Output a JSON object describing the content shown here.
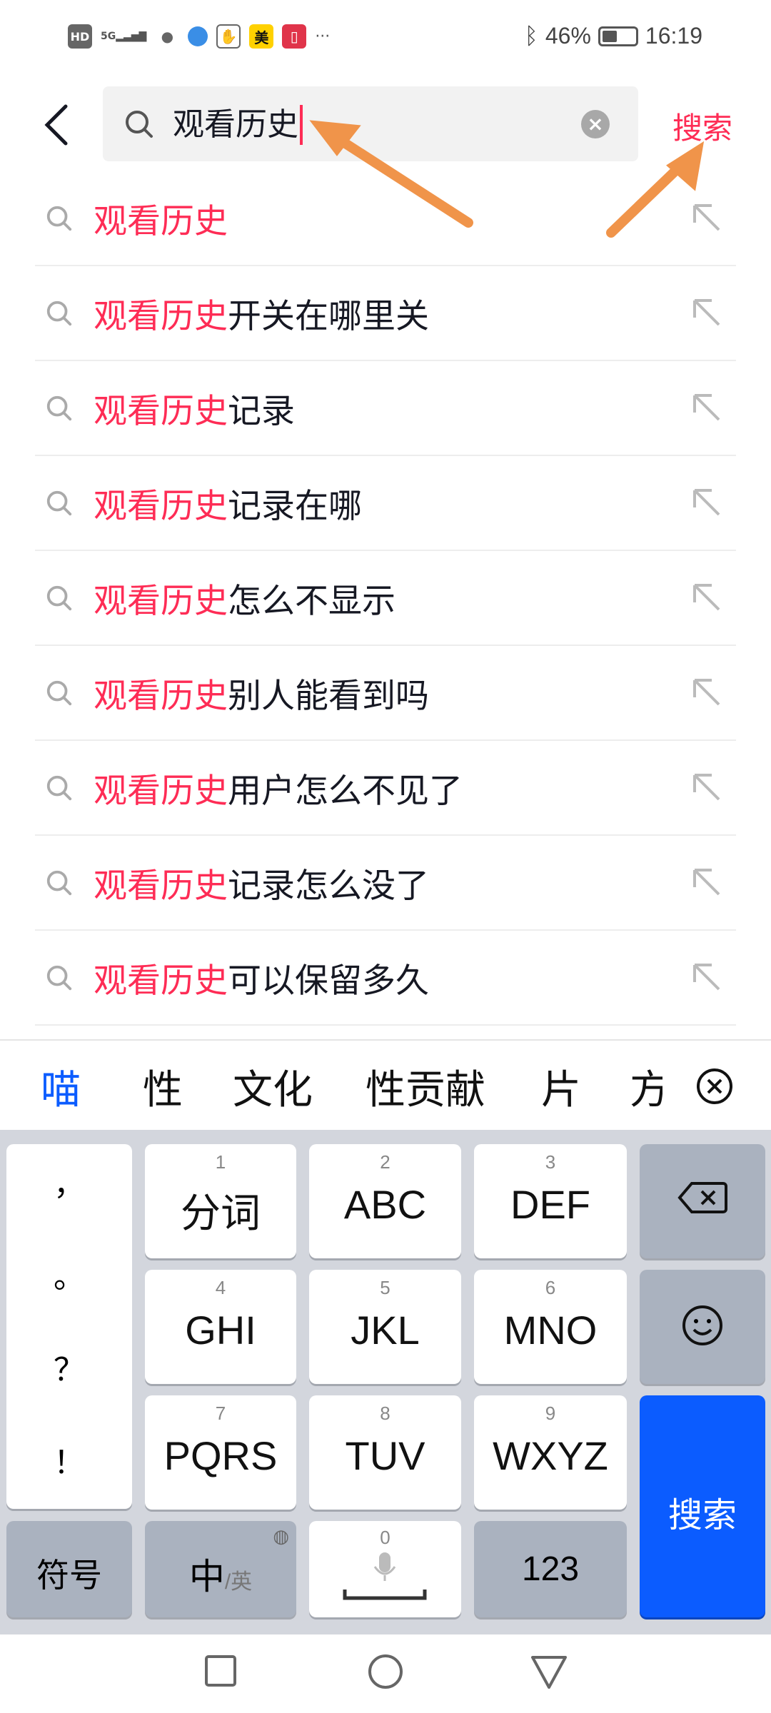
{
  "status_bar": {
    "left_icons": [
      "hd-icon",
      "5g-signal-icon",
      "wechat-icon",
      "browser-icon",
      "hand-icon",
      "meituan-icon",
      "book-icon",
      "more-icon"
    ],
    "hd": "HD",
    "meituan": "美",
    "more": "···",
    "battery": "46%",
    "battery_level": 0.46,
    "time": "16:19"
  },
  "search": {
    "query": "观看历史",
    "button": "搜索"
  },
  "suggestions": [
    {
      "highlight": "观看历史",
      "rest": ""
    },
    {
      "highlight": "观看历史",
      "rest": "开关在哪里关"
    },
    {
      "highlight": "观看历史",
      "rest": "记录"
    },
    {
      "highlight": "观看历史",
      "rest": "记录在哪"
    },
    {
      "highlight": "观看历史",
      "rest": "怎么不显示"
    },
    {
      "highlight": "观看历史",
      "rest": "别人能看到吗"
    },
    {
      "highlight": "观看历史",
      "rest": "用户怎么不见了"
    },
    {
      "highlight": "观看历史",
      "rest": "记录怎么没了"
    },
    {
      "highlight": "观看历史",
      "rest": "可以保留多久"
    }
  ],
  "candidates": [
    "喵",
    "性",
    "文化",
    "性贡献",
    "片",
    "方"
  ],
  "keyboard": {
    "punct": [
      "，",
      "。",
      "？",
      "！"
    ],
    "keys": [
      {
        "num": "1",
        "label": "分词"
      },
      {
        "num": "2",
        "label": "ABC"
      },
      {
        "num": "3",
        "label": "DEF"
      },
      {
        "num": "4",
        "label": "GHI"
      },
      {
        "num": "5",
        "label": "JKL"
      },
      {
        "num": "6",
        "label": "MNO"
      },
      {
        "num": "7",
        "label": "PQRS"
      },
      {
        "num": "8",
        "label": "TUV"
      },
      {
        "num": "9",
        "label": "WXYZ"
      }
    ],
    "symbol": "符号",
    "lang_main": "中",
    "lang_alt": "/英",
    "space_num": "0",
    "num_key": "123",
    "enter": "搜索"
  },
  "colors": {
    "accent": "#fe2c55",
    "enter": "#0b5cff",
    "annotation_arrow": "#f0944a"
  }
}
